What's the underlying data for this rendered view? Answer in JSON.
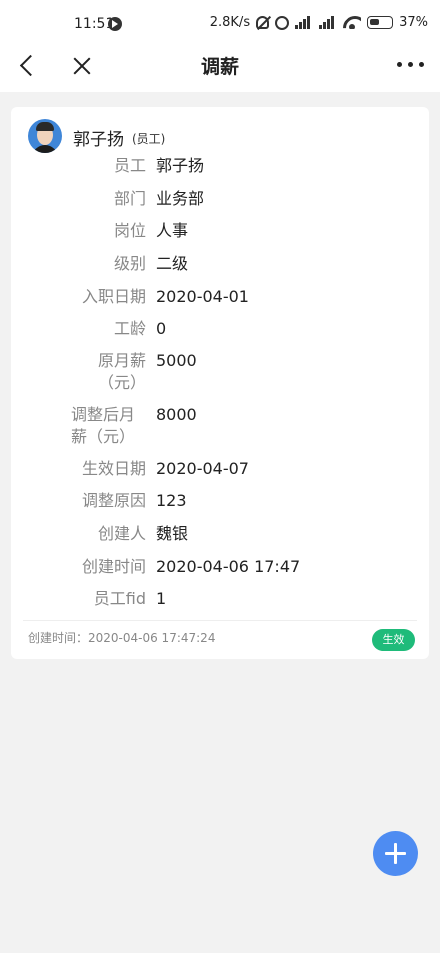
{
  "status_bar": {
    "time": "11:51",
    "net_speed": "2.8K/s",
    "battery": "37%"
  },
  "nav": {
    "title": "调薪"
  },
  "card": {
    "name": "郭子扬",
    "role": "(员工)",
    "fields": [
      {
        "label": "员工",
        "value": "郭子扬"
      },
      {
        "label": "部门",
        "value": "业务部"
      },
      {
        "label": "岗位",
        "value": "人事"
      },
      {
        "label": "级别",
        "value": "二级"
      },
      {
        "label": "入职日期",
        "value": "2020-04-01"
      },
      {
        "label": "工龄",
        "value": "0"
      },
      {
        "label": "原月薪（元）",
        "value": "5000"
      },
      {
        "label": "调整后月薪（元）",
        "value": "8000"
      },
      {
        "label": "生效日期",
        "value": "2020-04-07"
      },
      {
        "label": "调整原因",
        "value": "123"
      },
      {
        "label": "创建人",
        "value": "魏银"
      },
      {
        "label": "创建时间",
        "value": "2020-04-06 17:47"
      },
      {
        "label": "员工fid",
        "value": "1"
      }
    ],
    "created_at": "创建时间：2020-04-06 17:47:24",
    "status": "生效"
  },
  "colors": {
    "status_badge": "#1fbb7a",
    "fab": "#4e8cf2"
  }
}
